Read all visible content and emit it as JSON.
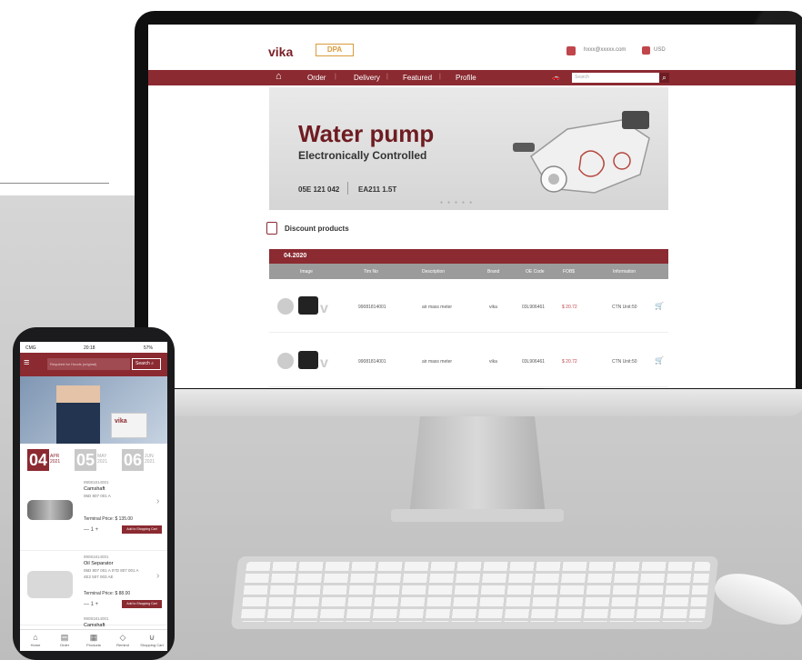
{
  "desktop": {
    "logo": "vika",
    "logo_secondary": "DPA",
    "user_email": "hxxx@xxxxx.com",
    "currency": "USD",
    "nav": {
      "home_icon": "home-icon",
      "items": [
        "Order",
        "Delivery",
        "Featured",
        "Profile"
      ],
      "search_placeholder": "Search",
      "search_icon": "search-icon"
    },
    "banner": {
      "title": "Water pump",
      "subtitle": "Electronically Controlled",
      "code1": "05E 121 042",
      "code2": "EA211 1.5T"
    },
    "discount": {
      "title": "Discount products",
      "month": "04.2020",
      "columns": [
        "Image",
        "Tim No",
        "Description",
        "Brand",
        "OE Code",
        "FOB$",
        "Information"
      ],
      "rows": [
        {
          "tim": "99081814001",
          "desc": "air mass meter",
          "brand": "vika",
          "oe": "03L906461",
          "price": "$ 20.72",
          "info": "CTN Unit:50"
        },
        {
          "tim": "99081814001",
          "desc": "air mass meter",
          "brand": "vika",
          "oe": "03L906461",
          "price": "$ 20.72",
          "info": "CTN Unit:50"
        }
      ]
    },
    "colors": {
      "brand": "#8b2a31",
      "price": "#c0464c"
    }
  },
  "phone": {
    "status": {
      "carrier": "CMG",
      "time": "20:18",
      "battery": "57%"
    },
    "search_placeholder": "Required for Hoods (original)",
    "search_label": "Search",
    "dates": [
      {
        "day": "04",
        "month": "APR",
        "year": "2021"
      },
      {
        "day": "05",
        "month": "MAY",
        "year": "2021"
      },
      {
        "day": "06",
        "month": "JUN",
        "year": "2021"
      }
    ],
    "products": [
      {
        "code": "99081814001",
        "name": "Camshaft",
        "oe": "06D 807 001 A",
        "oe2": "",
        "price_label": "Terminal Price:",
        "price": "$ 135.00",
        "qty": "1",
        "add_label": "Add to Shopping Cart"
      },
      {
        "code": "99081814001",
        "name": "Oil Separator",
        "oe": "06D 807 001 A   07D 807 001 A",
        "oe2": "4E2 507 003 AE",
        "price_label": "Terminal Price:",
        "price": "$ 88.00",
        "qty": "1",
        "add_label": "Add to Shopping Cart"
      },
      {
        "code": "99081814001",
        "name": "Camshaft"
      }
    ],
    "tabs": [
      "Home",
      "Order",
      "Products",
      "Remind",
      "Shopping Cart"
    ]
  }
}
